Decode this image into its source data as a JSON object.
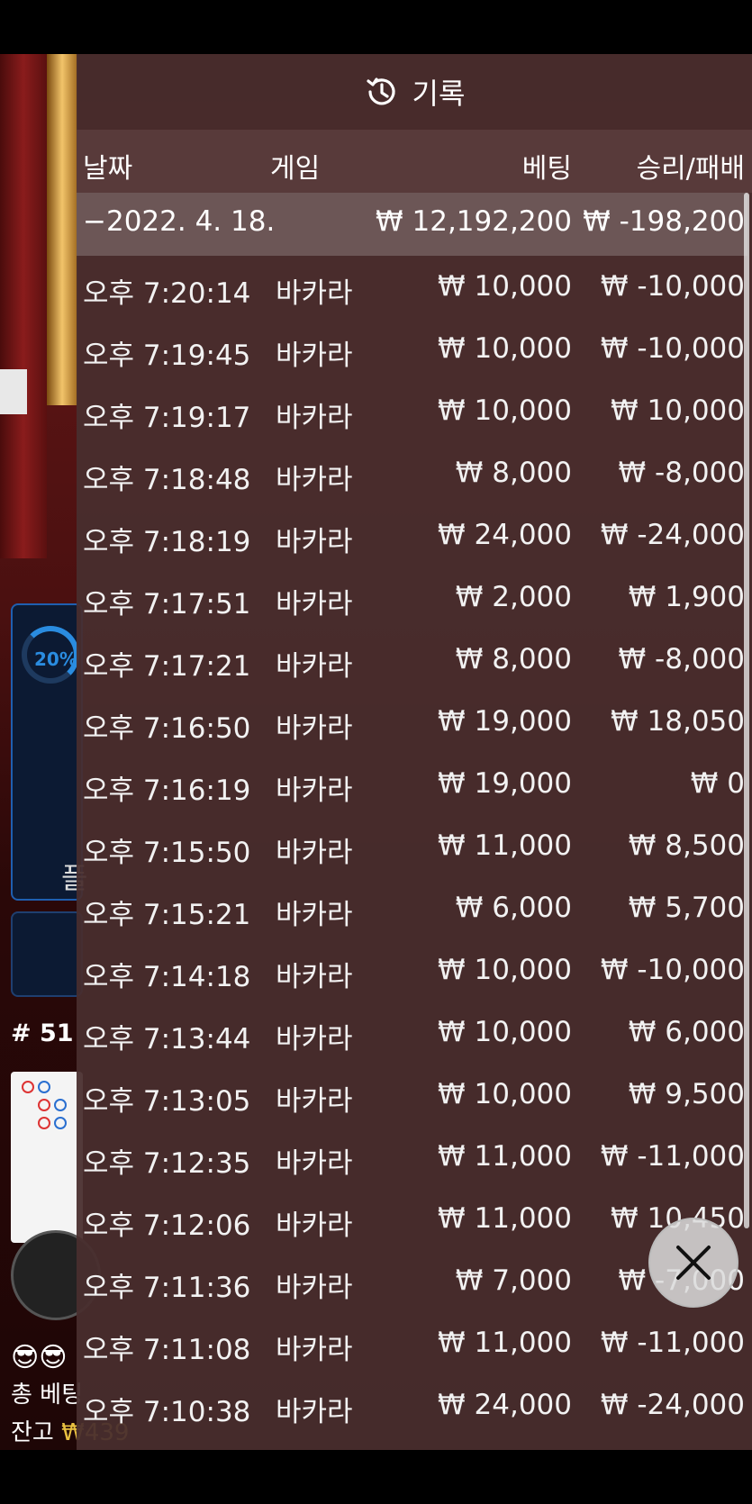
{
  "history": {
    "title": "기록",
    "columns": {
      "date": "날짜",
      "game": "게임",
      "bet": "베팅",
      "win_loss": "승리/패배"
    },
    "day_summary": {
      "date": "−2022. 4. 18.",
      "bet_total": "₩ 12,192,200",
      "win_loss_total": "₩ -198,200"
    },
    "rows": [
      {
        "time": "오후 7:20:14",
        "game": "바카라",
        "bet": "₩ 10,000",
        "result": "₩ -10,000"
      },
      {
        "time": "오후 7:19:45",
        "game": "바카라",
        "bet": "₩ 10,000",
        "result": "₩ -10,000"
      },
      {
        "time": "오후 7:19:17",
        "game": "바카라",
        "bet": "₩ 10,000",
        "result": "₩ 10,000"
      },
      {
        "time": "오후 7:18:48",
        "game": "바카라",
        "bet": "₩ 8,000",
        "result": "₩ -8,000"
      },
      {
        "time": "오후 7:18:19",
        "game": "바카라",
        "bet": "₩ 24,000",
        "result": "₩ -24,000"
      },
      {
        "time": "오후 7:17:51",
        "game": "바카라",
        "bet": "₩ 2,000",
        "result": "₩ 1,900"
      },
      {
        "time": "오후 7:17:21",
        "game": "바카라",
        "bet": "₩ 8,000",
        "result": "₩ -8,000"
      },
      {
        "time": "오후 7:16:50",
        "game": "바카라",
        "bet": "₩ 19,000",
        "result": "₩ 18,050"
      },
      {
        "time": "오후 7:16:19",
        "game": "바카라",
        "bet": "₩ 19,000",
        "result": "₩ 0"
      },
      {
        "time": "오후 7:15:50",
        "game": "바카라",
        "bet": "₩ 11,000",
        "result": "₩ 8,500"
      },
      {
        "time": "오후 7:15:21",
        "game": "바카라",
        "bet": "₩ 6,000",
        "result": "₩ 5,700"
      },
      {
        "time": "오후 7:14:18",
        "game": "바카라",
        "bet": "₩ 10,000",
        "result": "₩ -10,000"
      },
      {
        "time": "오후 7:13:44",
        "game": "바카라",
        "bet": "₩ 10,000",
        "result": "₩ 6,000"
      },
      {
        "time": "오후 7:13:05",
        "game": "바카라",
        "bet": "₩ 10,000",
        "result": "₩ 9,500"
      },
      {
        "time": "오후 7:12:35",
        "game": "바카라",
        "bet": "₩ 11,000",
        "result": "₩ -11,000"
      },
      {
        "time": "오후 7:12:06",
        "game": "바카라",
        "bet": "₩ 11,000",
        "result": "₩ 10,450"
      },
      {
        "time": "오후 7:11:36",
        "game": "바카라",
        "bet": "₩ 7,000",
        "result": "₩ -7,000"
      },
      {
        "time": "오후 7:11:08",
        "game": "바카라",
        "bet": "₩ 11,000",
        "result": "₩ -11,000"
      },
      {
        "time": "오후 7:10:38",
        "game": "바카라",
        "bet": "₩ 24,000",
        "result": "₩ -24,000"
      }
    ]
  },
  "game_bg": {
    "progress_label": "20%",
    "player_label": "플",
    "round_label": "# 51",
    "emoji": "😎😎",
    "total_bet_label": "총 베팅",
    "balance_label": "잔고",
    "balance_value": "₩439"
  },
  "colors": {
    "overlay": "#482e2e",
    "accent_blue": "#2a8ce0",
    "gold": "#e8c040"
  }
}
